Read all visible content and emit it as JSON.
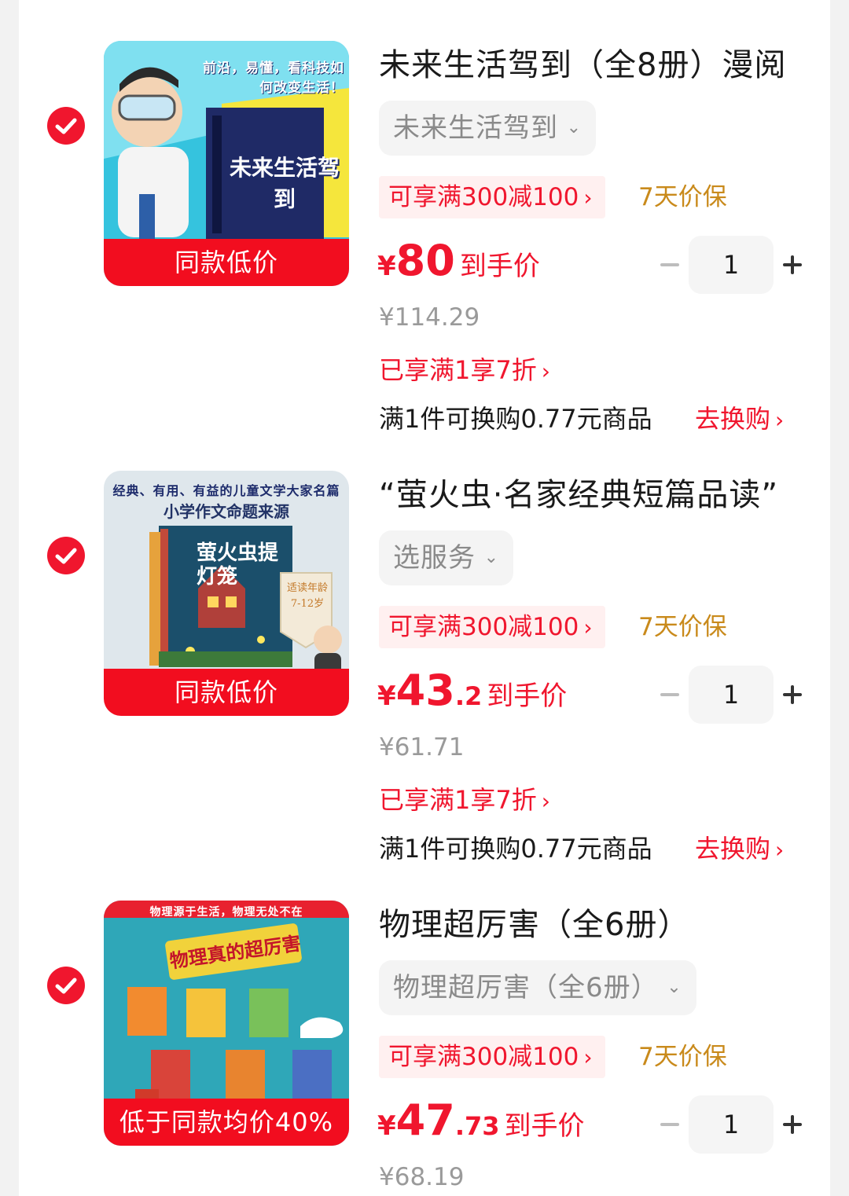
{
  "colors": {
    "accent_red": "#f0162e",
    "promo_bg": "#fff0f0",
    "price_protect": "#c98a1b",
    "muted_text": "#9a9a9a"
  },
  "items": [
    {
      "checked": true,
      "thumb_text_1": "前沿，易懂，看科技如何改变生活！",
      "thumb_text_2": "未来生活驾到",
      "thumb_badge": "同款低价",
      "title": "未来生活驾到（全8册）漫阅",
      "variant": "未来生活驾到",
      "promo": "可享满300减100",
      "price_protect": "7天价保",
      "price_yen": "¥",
      "price_int": "80",
      "price_dec": "",
      "price_suffix": "到手价",
      "quantity": "1",
      "original_price": "¥114.29",
      "discount": "已享满1享7折",
      "exchange": "满1件可换购0.77元商品",
      "exchange_action": "去换购"
    },
    {
      "checked": true,
      "thumb_text_1": "经典、有用、有益的儿童文学大家名篇",
      "thumb_text_2": "小学作文命题来源",
      "thumb_book": "萤火虫提灯笼",
      "thumb_age": "适读年龄 7-12岁",
      "thumb_badge": "同款低价",
      "title": "“萤火虫·名家经典短篇品读”",
      "variant": "选服务",
      "promo": "可享满300减100",
      "price_protect": "7天价保",
      "price_yen": "¥",
      "price_int": "43",
      "price_dec": ".2",
      "price_suffix": "到手价",
      "quantity": "1",
      "original_price": "¥61.71",
      "discount": "已享满1享7折",
      "exchange": "满1件可换购0.77元商品",
      "exchange_action": "去换购"
    },
    {
      "checked": true,
      "thumb_text_1": "物理源于生活，物理无处不在",
      "thumb_text_2": "物理真的超厉害",
      "thumb_badge": "低于同款均价40%",
      "title": "物理超厉害（全6册）",
      "variant": "物理超厉害（全6册）",
      "promo": "可享满300减100",
      "price_protect": "7天价保",
      "price_yen": "¥",
      "price_int": "47",
      "price_dec": ".73",
      "price_suffix": "到手价",
      "quantity": "1",
      "original_price": "¥68.19"
    }
  ]
}
